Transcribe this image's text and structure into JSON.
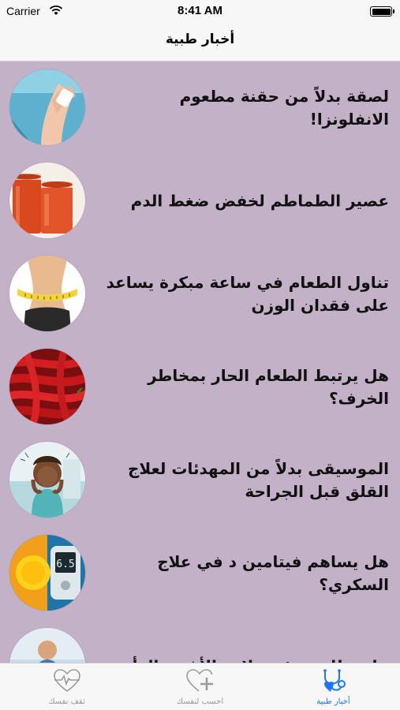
{
  "status_bar": {
    "carrier": "Carrier",
    "time": "8:41 AM"
  },
  "nav": {
    "title": "أخبار طبية"
  },
  "news": [
    {
      "title": "لصقة بدلاً من حقنة مطعوم الانفلونزا!",
      "image": "flu-patch-image"
    },
    {
      "title": "عصير الطماطم لخفض ضغط الدم",
      "image": "tomato-juice-image"
    },
    {
      "title": "تناول الطعام في ساعة مبكرة يساعد على فقدان الوزن",
      "image": "waist-measure-image"
    },
    {
      "title": "هل يرتبط الطعام الحار بمخاطر الخرف؟",
      "image": "chili-peppers-image"
    },
    {
      "title": "الموسيقى بدلاً من المهدئات لعلاج القلق قبل الجراحة",
      "image": "anxious-woman-image"
    },
    {
      "title": "هل يساهم فيتامين د في علاج السكري؟",
      "image": "glucose-meter-image"
    },
    {
      "title": "هل ضللت هيئة سلامة الأغذية الرأي",
      "image": "food-safety-image"
    }
  ],
  "tabs": [
    {
      "label": "ثقف نفسك",
      "icon": "heart-pulse-icon",
      "active": false
    },
    {
      "label": "احسب لنفسك",
      "icon": "heart-plus-icon",
      "active": false
    },
    {
      "label": "أخبار طبية",
      "icon": "stethoscope-heart-icon",
      "active": true
    }
  ],
  "colors": {
    "list_background": "#c3b1c8",
    "tab_active": "#1b77ff",
    "tab_inactive": "#999999"
  }
}
